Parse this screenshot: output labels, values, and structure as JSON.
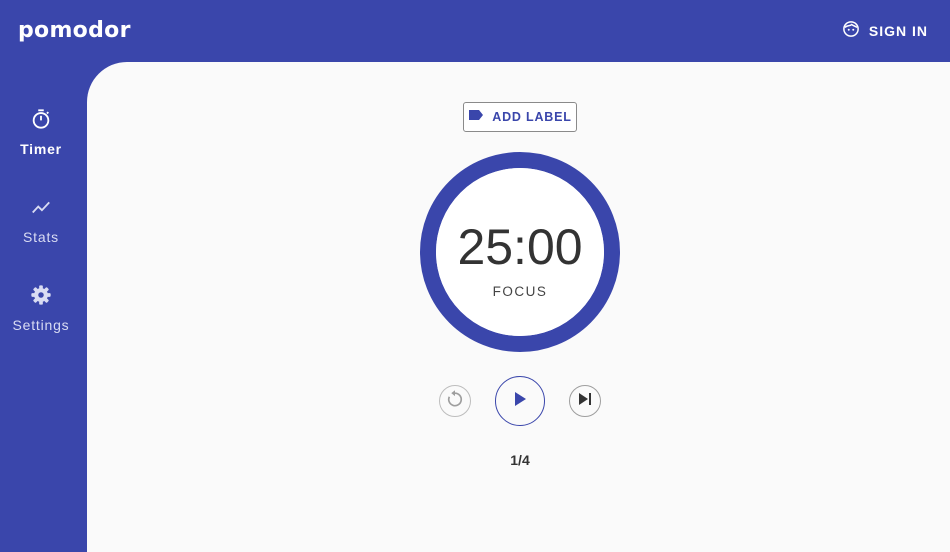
{
  "app": {
    "logo_text": "pomodor",
    "sign_in_label": "SIGN IN"
  },
  "sidebar": {
    "items": [
      {
        "label": "Timer",
        "icon": "stopwatch-icon",
        "active": true
      },
      {
        "label": "Stats",
        "icon": "trending-up-icon",
        "active": false
      },
      {
        "label": "Settings",
        "icon": "gear-icon",
        "active": false
      }
    ]
  },
  "timer": {
    "add_label": "ADD LABEL",
    "time": "25:00",
    "mode": "FOCUS",
    "session_counter": "1/4"
  },
  "colors": {
    "brand": "#3a46ab",
    "background": "#fafafa",
    "text": "#333333"
  }
}
